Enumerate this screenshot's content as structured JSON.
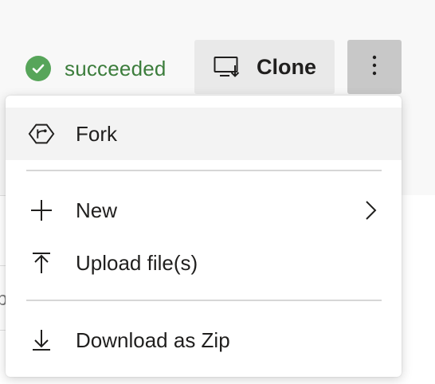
{
  "status": {
    "text": "succeeded",
    "icon": "check-circle-icon",
    "color": "#57a55a"
  },
  "toolbar": {
    "clone_label": "Clone",
    "clone_icon": "monitor-download-icon",
    "more_icon": "more-vertical-icon"
  },
  "menu": {
    "items": [
      {
        "label": "Fork",
        "icon": "fork-icon"
      },
      {
        "label": "New",
        "icon": "plus-icon",
        "submenu": true
      },
      {
        "label": "Upload file(s)",
        "icon": "upload-icon"
      },
      {
        "label": "Download as Zip",
        "icon": "download-icon"
      }
    ]
  }
}
